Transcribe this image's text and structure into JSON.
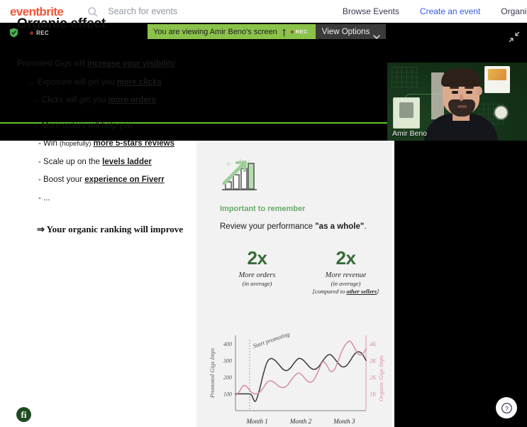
{
  "eventbrite_header": {
    "logo": "eventbrite",
    "search": {
      "placeholder": "Search for events",
      "value": "",
      "icon": "search-icon"
    },
    "nav": [
      {
        "label": "Browse Events",
        "accent": false
      },
      {
        "label": "Create an event",
        "accent": true
      },
      {
        "label": "Organize",
        "accent": false
      }
    ]
  },
  "meeting_bar": {
    "shield_icon": "shield-check-icon",
    "rec_label": "REC",
    "banner": {
      "viewing_text": "You are viewing Amir Beno's screen",
      "share_icon": "screen-share-icon",
      "rec_label": "REC",
      "view_options_label": "View Options",
      "chevron_icon": "chevron-down-icon"
    },
    "collapse_icon": "collapse-arrows-icon"
  },
  "webcam": {
    "participant_name": "Amir Beno"
  },
  "slide": {
    "title": "Organic effect",
    "bullets": [
      {
        "indent": 0,
        "prefix": "",
        "text": "Promoted Gigs will ",
        "emphasis": "increase your visibility",
        "suffix": ""
      },
      {
        "indent": 1,
        "prefix": "→ ",
        "text": "Exposure will get you ",
        "emphasis": "more clicks",
        "suffix": ""
      },
      {
        "indent": 2,
        "prefix": "→ ",
        "text": "Clicks will get you ",
        "emphasis": "more orders",
        "suffix": ""
      },
      {
        "indent": 3,
        "prefix": "→ ",
        "text": "More orders will help you",
        "emphasis": "",
        "suffix": ""
      },
      {
        "indent": 4,
        "prefix": "- ",
        "text": "Win ",
        "small": "(hopefully)",
        "emphasis": "more 5-stars reviews",
        "suffix": ""
      },
      {
        "indent": 4,
        "prefix": "- ",
        "text": "Scale up on the ",
        "emphasis": "levels ladder",
        "suffix": ""
      },
      {
        "indent": 4,
        "prefix": "- ",
        "text": "Boost your ",
        "emphasis": "experience on Fiverr",
        "suffix": ""
      },
      {
        "indent": 4,
        "prefix": "- ",
        "text": "...",
        "emphasis": "",
        "suffix": ""
      }
    ],
    "conclusion": "⇒ Your organic ranking will improve",
    "fiverr_logo": "fi",
    "right_panel": {
      "growth_icon": "growth-chart-arrow-icon",
      "important_label": "Important to remember",
      "review_prefix": "Review your performance ",
      "review_quote": "\"as a whole\"",
      "review_suffix": ".",
      "stats": [
        {
          "value": "2x",
          "caption": "More orders",
          "sub": "(in average)",
          "sub2": "",
          "sub2_emphasis": ""
        },
        {
          "value": "2x",
          "caption": "More revenue",
          "sub": "(in average)",
          "sub2_prefix": "[compared to ",
          "sub2_emphasis": "other sellers",
          "sub2_suffix": "]"
        }
      ]
    }
  },
  "chart_data": {
    "type": "line",
    "title": "",
    "xlabel": "",
    "ylabel": "Promoted Gigs Imps",
    "y2label": "Organic Gigs Imps",
    "categories": [
      "Month 1",
      "Month 2",
      "Month 3"
    ],
    "yticks": [
      100,
      200,
      300,
      400
    ],
    "y2ticks": [
      "1K",
      "2K",
      "3K",
      "4K"
    ],
    "ylim": [
      0,
      450
    ],
    "y2lim": [
      0,
      4500
    ],
    "annotation": "Start promoting",
    "annotation_x_month": 1,
    "grid": false,
    "legend": "none",
    "series": [
      {
        "name": "Promoted Gigs Imps",
        "axis": "left",
        "color": "#3a3a3a",
        "x": [
          0,
          3,
          6,
          9,
          12,
          15,
          18,
          21,
          24,
          27,
          30,
          33,
          36,
          39,
          42,
          45,
          48,
          51,
          54,
          57,
          60,
          63,
          66,
          69,
          72,
          75,
          78,
          81,
          84,
          87,
          90,
          93,
          96,
          99
        ],
        "values": [
          100,
          100,
          100,
          100,
          95,
          55,
          120,
          215,
          290,
          312,
          300,
          275,
          248,
          240,
          258,
          290,
          312,
          305,
          280,
          255,
          247,
          262,
          295,
          325,
          335,
          312,
          282,
          262,
          268,
          298,
          335,
          352,
          340,
          300
        ]
      },
      {
        "name": "Organic Gigs Imps",
        "axis": "right",
        "color": "#d98ba6",
        "x": [
          0,
          3,
          6,
          9,
          12,
          15,
          18,
          21,
          24,
          27,
          30,
          33,
          36,
          39,
          42,
          45,
          48,
          51,
          54,
          57,
          60,
          63,
          66,
          69,
          72,
          75,
          78,
          81,
          84,
          87,
          90,
          93,
          96,
          99
        ],
        "values": [
          900,
          1150,
          1500,
          1400,
          1100,
          1000,
          1080,
          1350,
          1700,
          1780,
          1650,
          1450,
          1380,
          1480,
          1800,
          2100,
          2250,
          2080,
          1800,
          1700,
          1900,
          2400,
          2900,
          2750,
          2350,
          2450,
          3000,
          3600,
          4000,
          4150,
          3800,
          3400,
          3350,
          3700
        ]
      }
    ]
  },
  "help_button": {
    "icon": "question-circle-icon",
    "label": "?"
  }
}
